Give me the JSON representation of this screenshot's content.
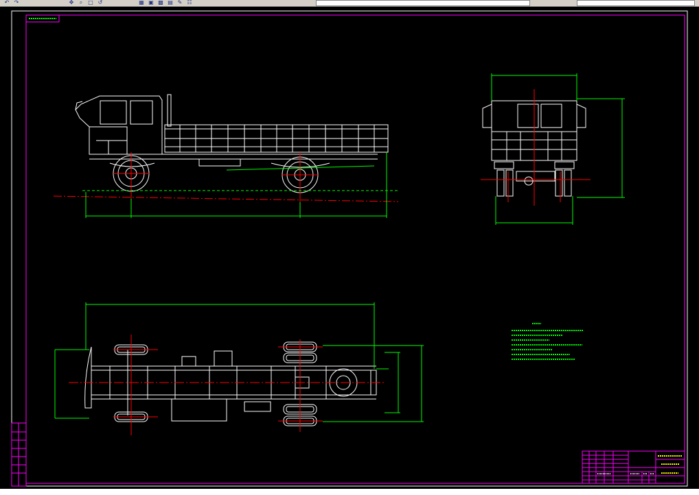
{
  "toolbar": {
    "buttons": [
      "undo-icon",
      "redo-icon",
      "pan-icon",
      "zoom-realtime-icon",
      "zoom-window-icon",
      "zoom-previous-icon",
      "properties-icon",
      "design-center-icon",
      "tool-palettes-icon",
      "sheet-set-icon",
      "markup-icon",
      "calculator-icon"
    ],
    "layer_field": "",
    "style_field": ""
  },
  "drawing": {
    "tag_label": "",
    "notes_title": "",
    "notes_lines": [
      "",
      "",
      "",
      "",
      "",
      "",
      ""
    ],
    "dimensions": {
      "side_overall": "",
      "side_front_overhang": "",
      "side_wheelbase": "",
      "side_rear_overhang": "",
      "top_overall": "",
      "top_frame_width": "",
      "top_track": "",
      "top_overall_width": "",
      "rear_width": "",
      "rear_height": "",
      "rear_track": ""
    }
  },
  "title_block": {
    "drawing_title": "",
    "subtitle": "",
    "drawing_number": ""
  },
  "colors": {
    "background": "#000000",
    "geometry": "#ffffff",
    "dimension": "#00ff00",
    "border": "#ff00ff",
    "centerline": "#ff0000",
    "title_text": "#ffff00"
  },
  "command_line": ""
}
